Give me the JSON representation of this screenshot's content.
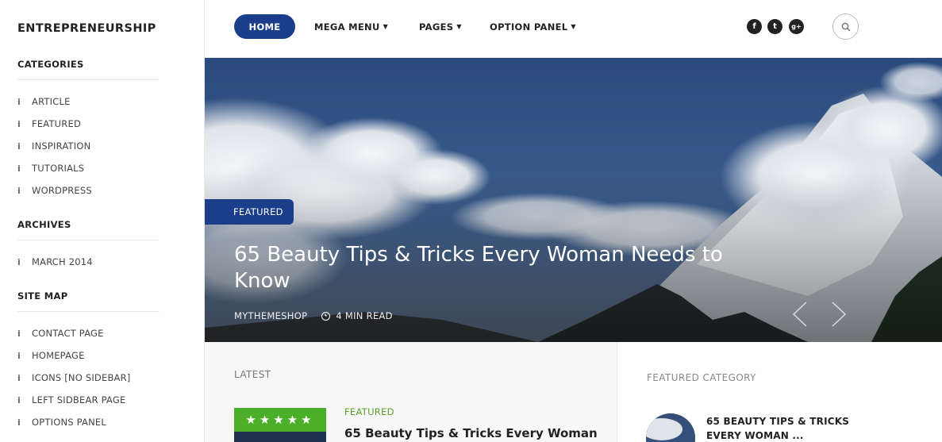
{
  "sidebar": {
    "site_title": "ENTREPRENEURSHIP",
    "categories": {
      "heading": "CATEGORIES",
      "items": [
        "ARTICLE",
        "FEATURED",
        "INSPIRATION",
        "TUTORIALS",
        "WORDPRESS"
      ]
    },
    "archives": {
      "heading": "ARCHIVES",
      "items": [
        "MARCH 2014"
      ]
    },
    "sitemap": {
      "heading": "SITE MAP",
      "items": [
        "CONTACT PAGE",
        "HOMEPAGE",
        "ICONS [NO SIDEBAR]",
        "LEFT SIDBEAR PAGE",
        "OPTIONS PANEL"
      ]
    },
    "bullet_glyph": "i"
  },
  "nav": {
    "home": "HOME",
    "mega_menu": "MEGA MENU",
    "pages": "PAGES",
    "option_panel": "OPTION PANEL",
    "caret": "▼"
  },
  "social": {
    "facebook": "f",
    "twitter": "t",
    "google": "g+"
  },
  "hero": {
    "badge": "FEATURED",
    "title": "65 Beauty Tips & Tricks Every Woman Needs to Know",
    "author": "MYTHEMESHOP",
    "read_time": "4 MIN READ"
  },
  "latest": {
    "heading": "LATEST",
    "stars": "★★★★★",
    "rating_stars": 5,
    "post_category": "FEATURED",
    "post_title": "65 Beauty Tips & Tricks Every Woman"
  },
  "featured_category": {
    "heading": "FEATURED CATEGORY",
    "post_title": "65 BEAUTY TIPS & TRICKS EVERY WOMAN ..."
  },
  "colors": {
    "accent_blue": "#1a3e8a",
    "rating_green": "#4caf2a",
    "category_green": "#5aa02c"
  }
}
